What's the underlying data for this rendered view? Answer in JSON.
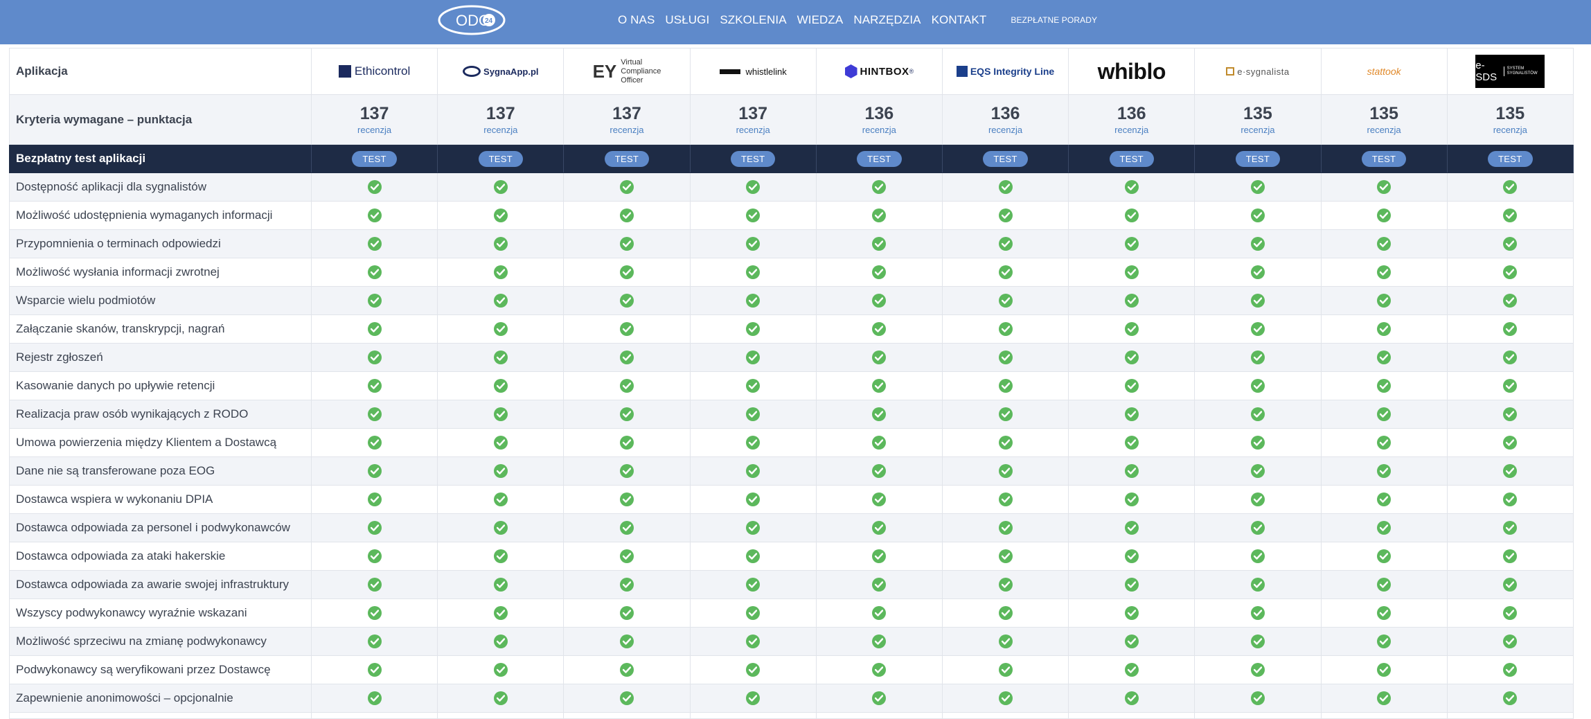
{
  "nav": {
    "logo_text": "ODO",
    "logo_badge": "24",
    "items": [
      "O NAS",
      "USŁUGI",
      "SZKOLENIA",
      "WIEDZA",
      "NARZĘDZIA",
      "KONTAKT"
    ],
    "cta": "BEZPŁATNE PORADY"
  },
  "table": {
    "app_label": "Aplikacja",
    "score_label": "Kryteria wymagane – punktacja",
    "test_label": "Bezpłatny test aplikacji",
    "test_button": "TEST",
    "review_link": "recenzja",
    "vendors": [
      {
        "name": "Ethicontrol",
        "score": "137"
      },
      {
        "name": "SygnaApp.pl",
        "score": "137"
      },
      {
        "name": "EY Virtual Compliance Officer",
        "score": "137",
        "logo_big": "EY",
        "logo_lines": [
          "Virtual",
          "Compliance",
          "Officer"
        ]
      },
      {
        "name": "whistlelink",
        "score": "137"
      },
      {
        "name": "HINTBOX",
        "score": "136",
        "logo_mark": "®"
      },
      {
        "name": "EQS Integrity Line",
        "score": "136"
      },
      {
        "name": "whiblo",
        "score": "136"
      },
      {
        "name": "e·sygnalista",
        "score": "135"
      },
      {
        "name": "stattook",
        "score": "135"
      },
      {
        "name": "e-SDS",
        "score": "135",
        "logo_sub": "SYSTEM SYGNALISTÓW"
      }
    ],
    "features": [
      "Dostępność aplikacji dla sygnalistów",
      "Możliwość udostępnienia wymaganych informacji",
      "Przypomnienia o terminach odpowiedzi",
      "Możliwość wysłania informacji zwrotnej",
      "Wsparcie wielu podmiotów",
      "Załączanie skanów, transkrypcji, nagrań",
      "Rejestr zgłoszeń",
      "Kasowanie danych po upływie retencji",
      "Realizacja praw osób wynikających z RODO",
      "Umowa powierzenia między Klientem a Dostawcą",
      "Dane nie są transferowane poza EOG",
      "Dostawca wspiera w wykonaniu DPIA",
      "Dostawca odpowiada za personel i podwykonawców",
      "Dostawca odpowiada za ataki hakerskie",
      "Dostawca odpowiada za awarie swojej infrastruktury",
      "Wszyscy podwykonawcy wyraźnie wskazani",
      "Możliwość sprzeciwu na zmianę podwykonawcy",
      "Podwykonawcy są weryfikowani przez Dostawcę",
      "Zapewnienie anonimowości – opcjonalnie"
    ],
    "check_icon": "check-circle-icon",
    "colors": {
      "check": "#5cb85c",
      "nav": "#5f8acb",
      "test_row": "#1e2b45",
      "link": "#4a7fc1"
    }
  }
}
